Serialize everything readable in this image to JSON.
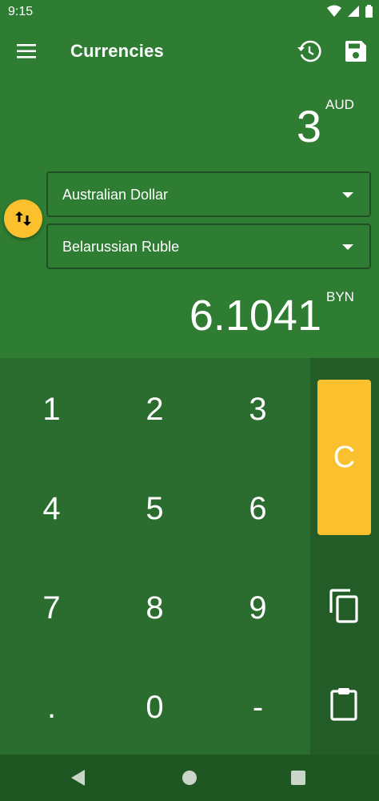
{
  "status_bar": {
    "time": "9:15"
  },
  "app_bar": {
    "title": "Currencies"
  },
  "conversion": {
    "from_amount": "3",
    "from_code": "AUD",
    "from_currency": "Australian Dollar",
    "to_currency": "Belarussian Ruble",
    "to_amount": "6.1041",
    "to_code": "BYN"
  },
  "keypad": {
    "k1": "1",
    "k2": "2",
    "k3": "3",
    "k4": "4",
    "k5": "5",
    "k6": "6",
    "k7": "7",
    "k8": "8",
    "k9": "9",
    "kdot": ".",
    "k0": "0",
    "kminus": "-"
  },
  "side": {
    "clear_label": "C"
  },
  "colors": {
    "primary": "#2e7d32",
    "keypad": "#2a6d2e",
    "accent": "#fbc02d"
  },
  "icons": [
    "menu-icon",
    "history-icon",
    "save-icon",
    "swap-icon",
    "copy-icon",
    "paste-icon"
  ]
}
